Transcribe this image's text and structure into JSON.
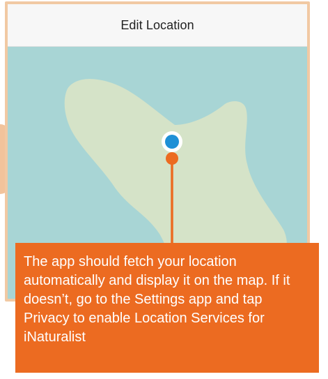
{
  "nav": {
    "title": "Edit Location"
  },
  "callout": {
    "text": "The app should fetch your location automatically and display it on the map. If it doesn’t, go to the Settings app and tap Privacy to enable Location Services for iNaturalist"
  },
  "colors": {
    "accent": "#ec6b21",
    "water": "#a8d5d5",
    "land": "#d5e3c8",
    "location_dot": "#1e90d6"
  },
  "icons": {
    "marker": "current-location-icon"
  }
}
